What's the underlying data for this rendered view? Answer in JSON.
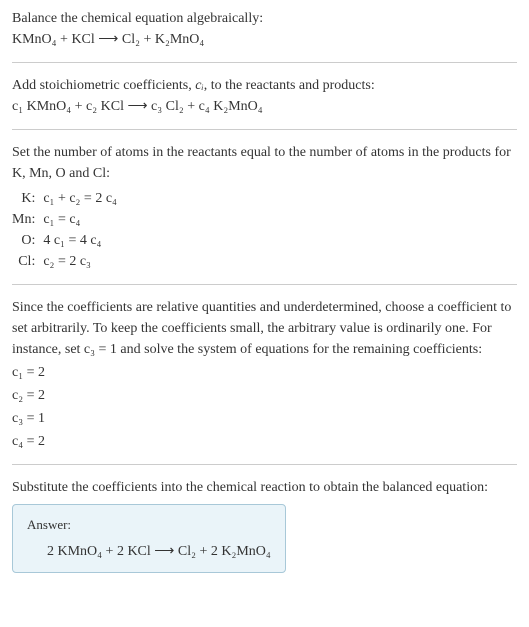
{
  "instr1": "Balance the chemical equation algebraically:",
  "eq1": "KMnO₄ + KCl ⟶ Cl₂ + K₂MnO₄",
  "instr2_a": "Add stoichiometric coefficients, ",
  "instr2_ci": "cᵢ",
  "instr2_b": ", to the reactants and products:",
  "eq2": "c₁ KMnO₄ + c₂ KCl ⟶ c₃ Cl₂ + c₄ K₂MnO₄",
  "instr3": "Set the number of atoms in the reactants equal to the number of atoms in the products for K, Mn, O and Cl:",
  "atom_eqs": [
    {
      "label": "K:",
      "eq": "c₁ + c₂ = 2 c₄"
    },
    {
      "label": "Mn:",
      "eq": "c₁ = c₄"
    },
    {
      "label": "O:",
      "eq": "4 c₁ = 4 c₄"
    },
    {
      "label": "Cl:",
      "eq": "c₂ = 2 c₃"
    }
  ],
  "instr4": "Since the coefficients are relative quantities and underdetermined, choose a coefficient to set arbitrarily. To keep the coefficients small, the arbitrary value is ordinarily one. For instance, set c₃ = 1 and solve the system of equations for the remaining coefficients:",
  "coefs": [
    "c₁ = 2",
    "c₂ = 2",
    "c₃ = 1",
    "c₄ = 2"
  ],
  "instr5": "Substitute the coefficients into the chemical reaction to obtain the balanced equation:",
  "answer_label": "Answer:",
  "answer_eq": "2 KMnO₄ + 2 KCl ⟶ Cl₂ + 2 K₂MnO₄"
}
